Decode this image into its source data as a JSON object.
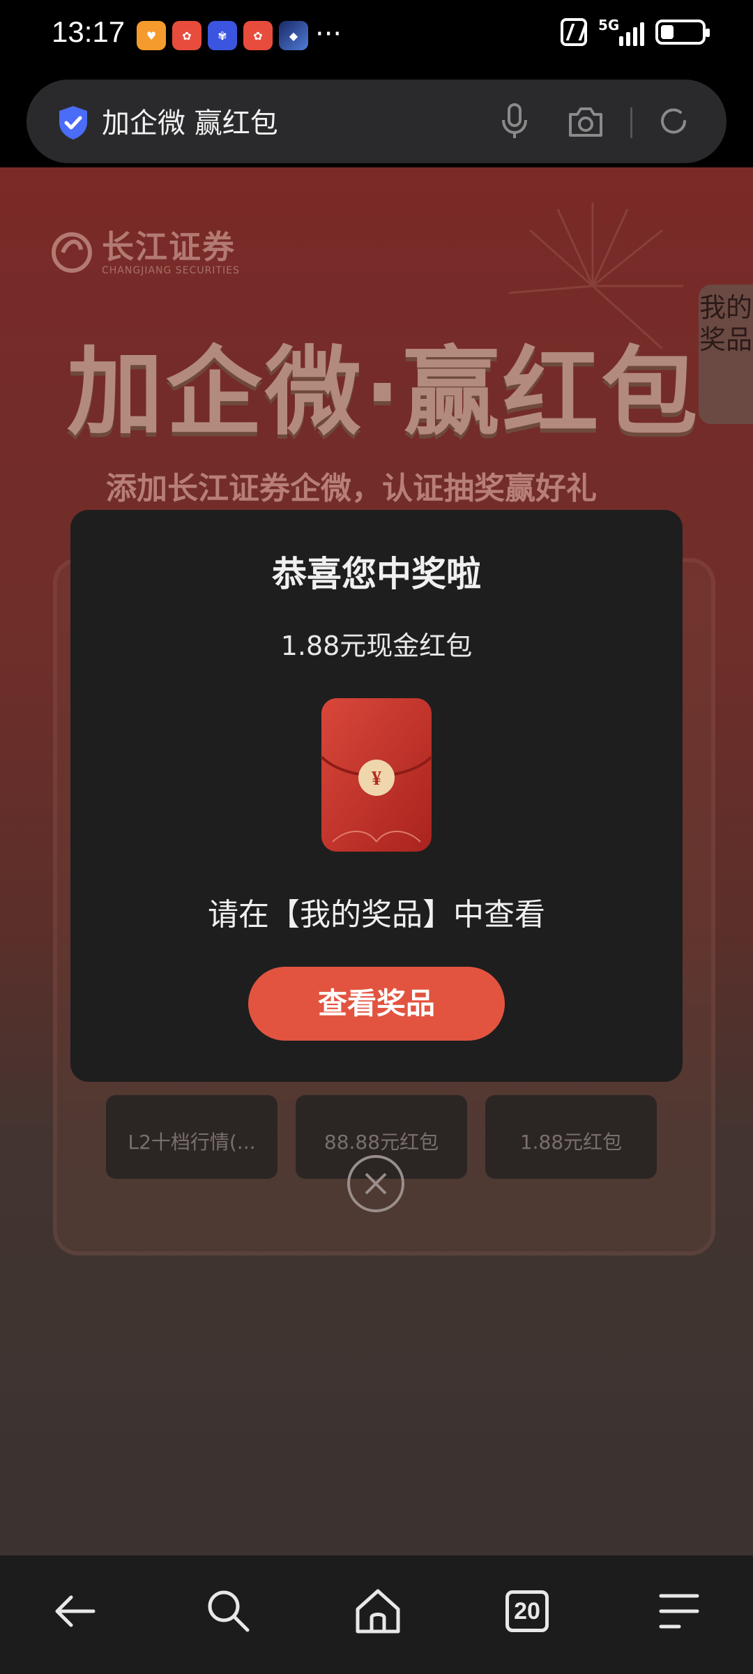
{
  "status_bar": {
    "time": "13:17",
    "more": "···",
    "network": "5G"
  },
  "address_bar": {
    "query": "加企微 赢红包"
  },
  "page": {
    "logo_cn": "长江证券",
    "logo_en": "CHANGJIANG SECURITIES",
    "headline": "加企微·赢红包",
    "subline": "添加长江证券企微，认证抽奖赢好礼",
    "prize_tab": "我的奖品",
    "prize_cards": [
      "L2十档行情(...",
      "88.88元红包",
      "1.88元红包"
    ]
  },
  "modal": {
    "title": "恭喜您中奖啦",
    "prize": "1.88元现金红包",
    "envelope_symbol": "¥",
    "hint": "请在【我的奖品】中查看",
    "button": "查看奖品"
  },
  "bottom_nav": {
    "tabs_count": "20"
  },
  "colors": {
    "accent_button": "#e25440",
    "modal_bg": "#1e1e1e",
    "shield": "#4a6cf7"
  }
}
